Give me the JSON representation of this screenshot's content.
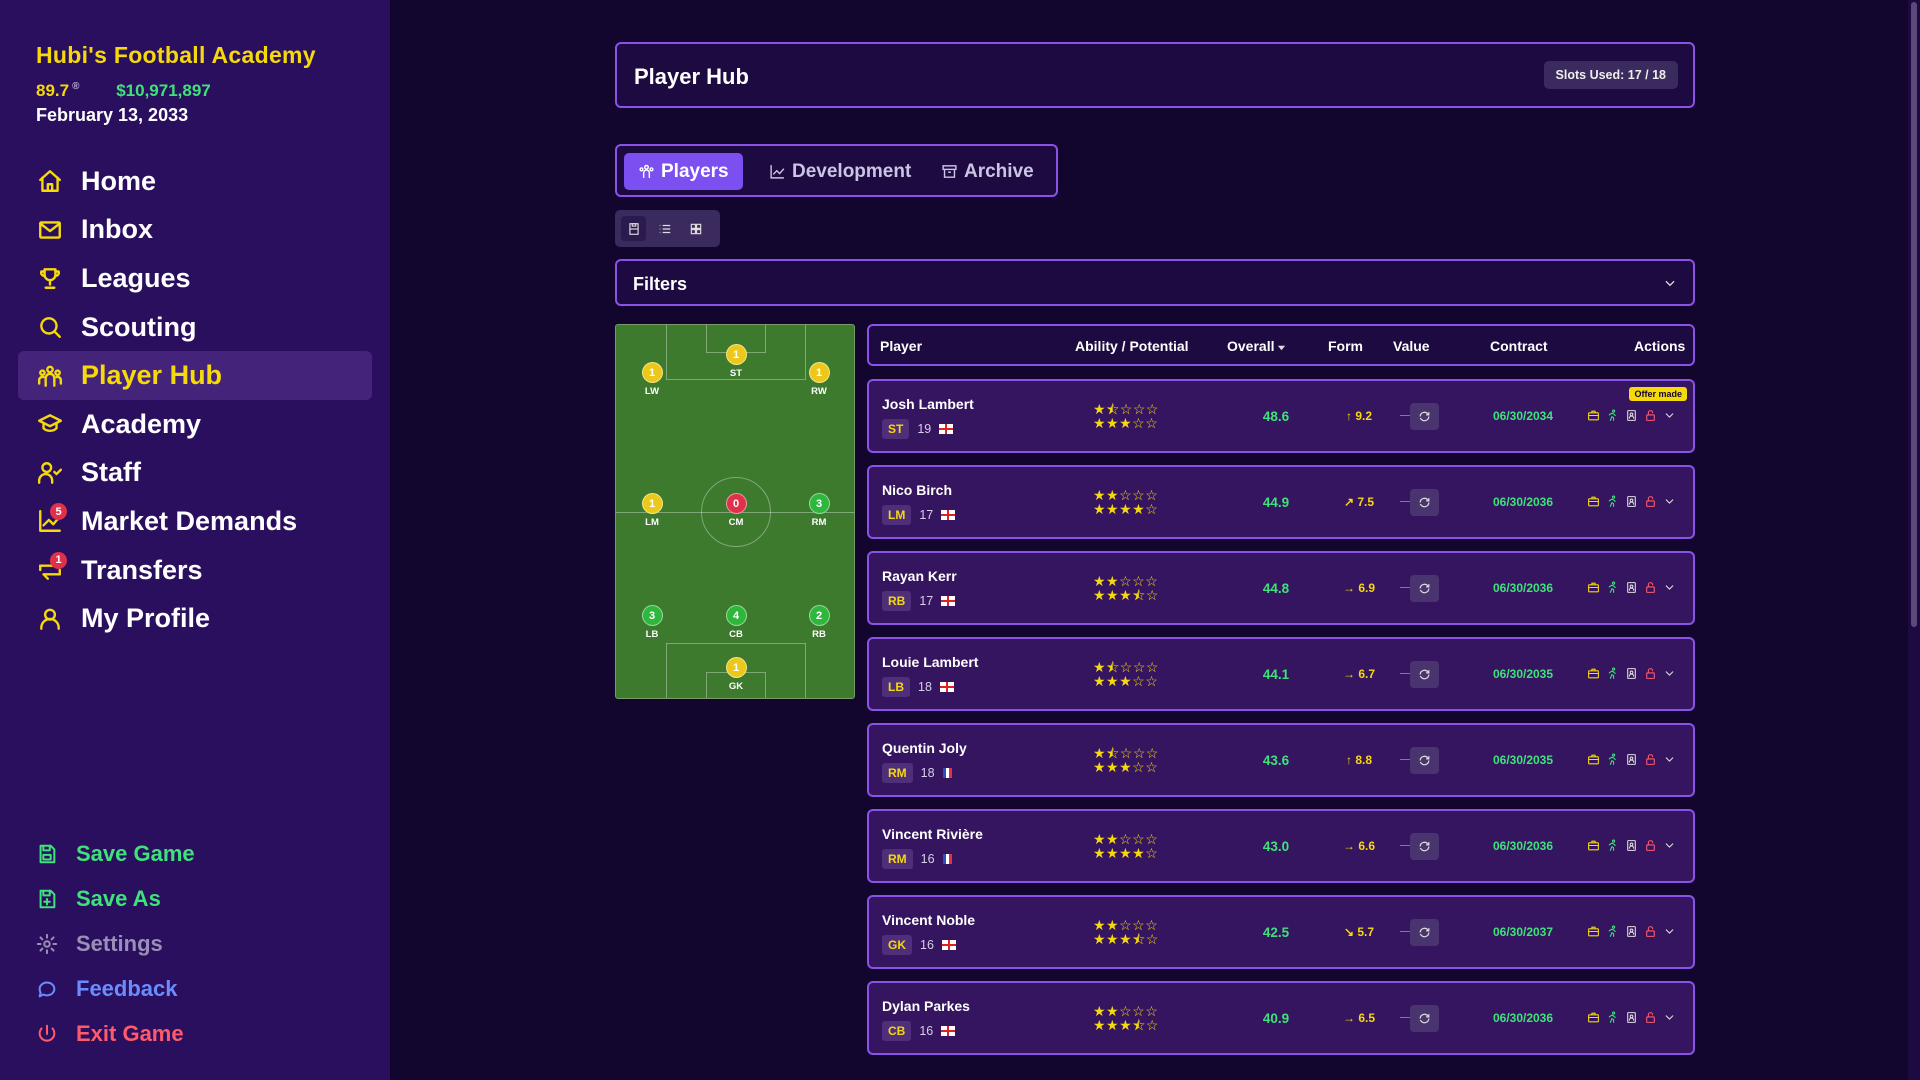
{
  "sidebar": {
    "club_name": "Hubi's Football Academy",
    "rating": "89.7",
    "rating_suffix": "®",
    "money": "$10,971,897",
    "date": "February 13, 2033",
    "nav": [
      {
        "label": "Home",
        "icon": "home-icon"
      },
      {
        "label": "Inbox",
        "icon": "mail-icon"
      },
      {
        "label": "Leagues",
        "icon": "trophy-icon"
      },
      {
        "label": "Scouting",
        "icon": "search-icon"
      },
      {
        "label": "Player Hub",
        "icon": "players-icon",
        "active": true
      },
      {
        "label": "Academy",
        "icon": "graduation-cap-icon"
      },
      {
        "label": "Staff",
        "icon": "staff-icon"
      },
      {
        "label": "Market Demands",
        "icon": "chart-icon",
        "badge": "5"
      },
      {
        "label": "Transfers",
        "icon": "transfer-icon",
        "badge": "1"
      },
      {
        "label": "My Profile",
        "icon": "user-icon"
      }
    ],
    "bottom": [
      {
        "label": "Save Game",
        "color": "#3ee27a",
        "icon": "save-icon"
      },
      {
        "label": "Save As",
        "color": "#3ee27a",
        "icon": "save-as-icon"
      },
      {
        "label": "Settings",
        "color": "#9a8fb8",
        "icon": "gear-icon"
      },
      {
        "label": "Feedback",
        "color": "#6a8cff",
        "icon": "chat-icon"
      },
      {
        "label": "Exit Game",
        "color": "#ff5a6a",
        "icon": "power-icon"
      }
    ]
  },
  "header": {
    "title": "Player Hub",
    "slots": "Slots Used: 17 / 18"
  },
  "tabs": [
    {
      "label": "Players",
      "active": true
    },
    {
      "label": "Development"
    },
    {
      "label": "Archive"
    }
  ],
  "filters": {
    "label": "Filters"
  },
  "pitch": [
    {
      "pos": "ST",
      "count": "1",
      "color": "yellow"
    },
    {
      "pos": "LW",
      "count": "1",
      "color": "yellow"
    },
    {
      "pos": "RW",
      "count": "1",
      "color": "yellow"
    },
    {
      "pos": "LM",
      "count": "1",
      "color": "yellow"
    },
    {
      "pos": "CM",
      "count": "0",
      "color": "red"
    },
    {
      "pos": "RM",
      "count": "3",
      "color": "green"
    },
    {
      "pos": "LB",
      "count": "3",
      "color": "green"
    },
    {
      "pos": "CB",
      "count": "4",
      "color": "green"
    },
    {
      "pos": "RB",
      "count": "2",
      "color": "green"
    },
    {
      "pos": "GK",
      "count": "1",
      "color": "yellow"
    }
  ],
  "table": {
    "headers": {
      "player": "Player",
      "ability": "Ability / Potential",
      "overall": "Overall",
      "form": "Form",
      "value": "Value",
      "contract": "Contract",
      "actions": "Actions"
    },
    "rows": [
      {
        "name": "Josh Lambert",
        "pos": "ST",
        "age": "19",
        "nat": "eng",
        "ability": 1.5,
        "potential": 3,
        "overall": "48.6",
        "form": "9.2",
        "form_trend": "up",
        "value": "—",
        "contract": "06/30/2034",
        "badge": "Offer made"
      },
      {
        "name": "Nico Birch",
        "pos": "LM",
        "age": "17",
        "nat": "eng",
        "ability": 2,
        "potential": 4,
        "overall": "44.9",
        "form": "7.5",
        "form_trend": "up-right",
        "value": "—",
        "contract": "06/30/2036"
      },
      {
        "name": "Rayan Kerr",
        "pos": "RB",
        "age": "17",
        "nat": "eng",
        "ability": 2,
        "potential": 3.5,
        "overall": "44.8",
        "form": "6.9",
        "form_trend": "right",
        "value": "—",
        "contract": "06/30/2036"
      },
      {
        "name": "Louie Lambert",
        "pos": "LB",
        "age": "18",
        "nat": "eng",
        "ability": 1.5,
        "potential": 3,
        "overall": "44.1",
        "form": "6.7",
        "form_trend": "right",
        "value": "—",
        "contract": "06/30/2035"
      },
      {
        "name": "Quentin Joly",
        "pos": "RM",
        "age": "18",
        "nat": "fra",
        "ability": 1.5,
        "potential": 3,
        "overall": "43.6",
        "form": "8.8",
        "form_trend": "up",
        "value": "—",
        "contract": "06/30/2035"
      },
      {
        "name": "Vincent Rivière",
        "pos": "RM",
        "age": "16",
        "nat": "fra",
        "ability": 2,
        "potential": 4,
        "overall": "43.0",
        "form": "6.6",
        "form_trend": "right",
        "value": "—",
        "contract": "06/30/2036"
      },
      {
        "name": "Vincent Noble",
        "pos": "GK",
        "age": "16",
        "nat": "eng",
        "ability": 2,
        "potential": 3.5,
        "overall": "42.5",
        "form": "5.7",
        "form_trend": "down-right",
        "value": "—",
        "contract": "06/30/2037"
      },
      {
        "name": "Dylan Parkes",
        "pos": "CB",
        "age": "16",
        "nat": "eng",
        "ability": 2,
        "potential": 3.5,
        "overall": "40.9",
        "form": "6.5",
        "form_trend": "right",
        "value": "—",
        "contract": "06/30/2036"
      }
    ]
  }
}
